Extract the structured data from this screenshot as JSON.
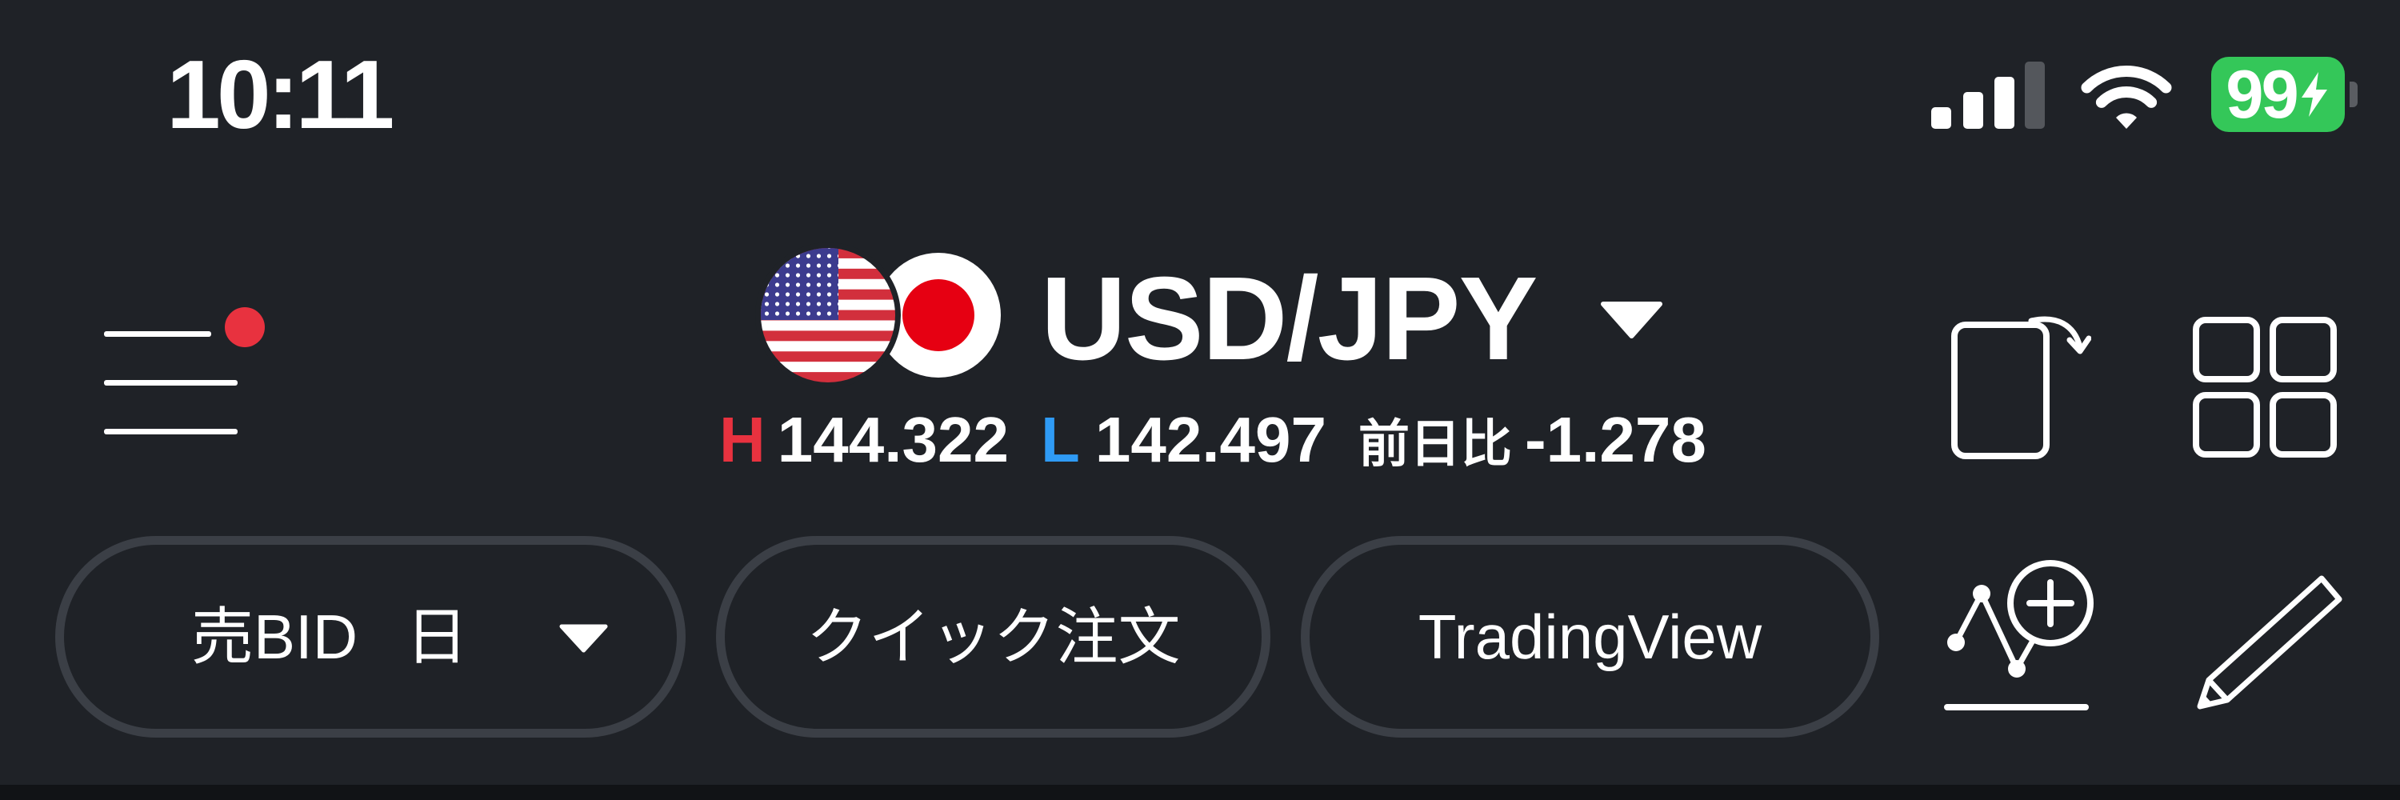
{
  "status_bar": {
    "time": "10:11",
    "battery_level": "99",
    "charging": true,
    "signal_bars": 3,
    "signal_bars_max": 4
  },
  "header": {
    "currency_pair": "USD/JPY",
    "high_label": "H",
    "high_value": "144.322",
    "low_label": "L",
    "low_value": "142.497",
    "change_label": "前日比",
    "change_value": "-1.278",
    "menu_has_notification": true
  },
  "toolbar": {
    "bid_label": "売BID",
    "period_label": "日",
    "quick_order_label": "クイック注文",
    "tradingview_label": "TradingView"
  },
  "icons": {
    "menu": "hamburger-menu-icon",
    "notification": "notification-dot-icon",
    "pair_flags": [
      "us-flag-icon",
      "japan-flag-icon"
    ],
    "pair_dropdown": "chevron-down-icon",
    "rotate": "rotate-screen-icon",
    "layout": "grid-layout-icon",
    "period_dropdown": "chevron-down-icon",
    "add_indicator": "add-indicator-icon",
    "draw": "pencil-icon",
    "signal": "cellular-signal-icon",
    "wifi": "wifi-icon",
    "battery": "battery-charging-icon"
  },
  "colors": {
    "background": "#1f2227",
    "high": "#e8323f",
    "low": "#2f9bf5",
    "notification": "#e8323f",
    "battery": "#34c759",
    "button_border": "#3b3f46"
  }
}
